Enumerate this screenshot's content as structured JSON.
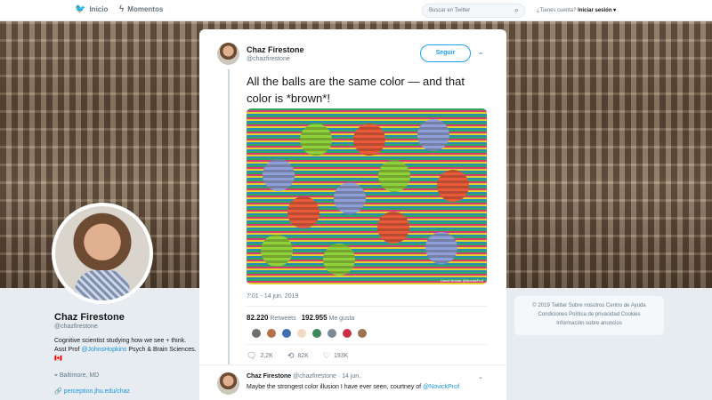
{
  "nav": {
    "home": "Inicio",
    "moments": "Momentos"
  },
  "search": {
    "placeholder": "Buscar en Twitter"
  },
  "account": {
    "question": "¿Tienes cuenta?",
    "login": "Iniciar sesión ▾"
  },
  "profile": {
    "name": "Chaz Firestone",
    "handle": "@chazfirestone",
    "bio_prefix": "Cognitive scientist studying how we see + think. Asst Prof ",
    "bio_link": "@JohnsHopkins",
    "bio_suffix": " Psych & Brain Sciences. 🇨🇦",
    "location": "Baltimore, MD",
    "website": "perception.jhu.edu/chaz"
  },
  "footer": {
    "line1": "© 2019 Twitter  Sobre nosotros  Centro de Ayuda",
    "line2": "Condiciones  Política de privacidad  Cookies",
    "line3": "Información sobre anuncios"
  },
  "tweet": {
    "author": "Chaz Firestone",
    "handle": "@chazfirestone",
    "follow": "Seguir",
    "text": "All the balls are the same color — and that color is *brown*!",
    "image_credit": "David Novick  @NovickProf",
    "time": "7:01 - 14 jun. 2019",
    "retweets": "82.220",
    "retweets_label": "Retweets",
    "likes": "192.955",
    "likes_label": "Me gusta",
    "reply_count": "2,2K",
    "retweet_count": "82K",
    "like_count": "193K",
    "likers": [
      "#6e6e6e",
      "#b86f4a",
      "#3f6fb0",
      "#f2d9c4",
      "#3c8a5a",
      "#7a8a99",
      "#c93045",
      "#9b7350"
    ]
  },
  "reply": {
    "author": "Chaz Firestone",
    "handle": "@chazfirestone",
    "date": "14 jun.",
    "text": "Maybe the strongest color illusion I have ever seen, courtney of ",
    "mention": "@NovickProf"
  },
  "colors": {
    "accent": "#1da1f2",
    "ball_green": "#8fd13a",
    "ball_red": "#e85a3a",
    "ball_blue": "#8fa0d8"
  }
}
